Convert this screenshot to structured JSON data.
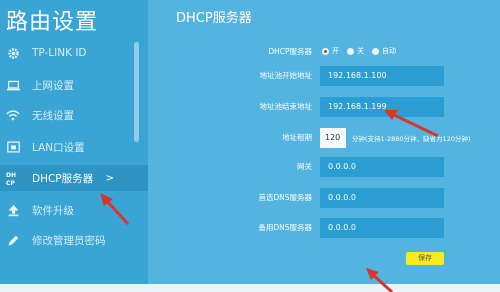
{
  "sidebar": {
    "title": "路由设置",
    "items": [
      {
        "label": "TP-LINK ID",
        "icon": "gear-icon"
      },
      {
        "label": "上网设置",
        "icon": "laptop-icon"
      },
      {
        "label": "无线设置",
        "icon": "wifi-icon"
      },
      {
        "label": "LAN口设置",
        "icon": "lan-port-icon"
      },
      {
        "label": "DHCP服务器",
        "icon": "dhcp-icon",
        "active": true,
        "chevron": ">"
      },
      {
        "label": "软件升级",
        "icon": "upgrade-icon"
      },
      {
        "label": "修改管理员密码",
        "icon": "pencil-icon"
      }
    ]
  },
  "main": {
    "title": "DHCP服务器",
    "dhcp_server": {
      "label": "DHCP服务器",
      "options": [
        "开",
        "关",
        "自动"
      ],
      "selected": "开"
    },
    "start_address": {
      "label": "地址池开始地址",
      "value": "192.168.1.100"
    },
    "end_address": {
      "label": "地址池结束地址",
      "value": "192.168.1.199"
    },
    "lease_time": {
      "label": "地址租期",
      "value": "120",
      "hint": "分钟(支持1-2880分钟，缺省为120分钟)"
    },
    "gateway": {
      "label": "网关",
      "value": "0.0.0.0"
    },
    "primary_dns": {
      "label": "首选DNS服务器",
      "value": "0.0.0.0"
    },
    "secondary_dns": {
      "label": "备用DNS服务器",
      "value": "0.0.0.0"
    },
    "save_label": "保存"
  },
  "colors": {
    "sidebar_bg": "#3aa5d4",
    "main_bg": "#53b5df",
    "input_bg": "#2a9ed2",
    "save_button": "#f7ea1f",
    "annotation_arrow": "#d9362b"
  }
}
